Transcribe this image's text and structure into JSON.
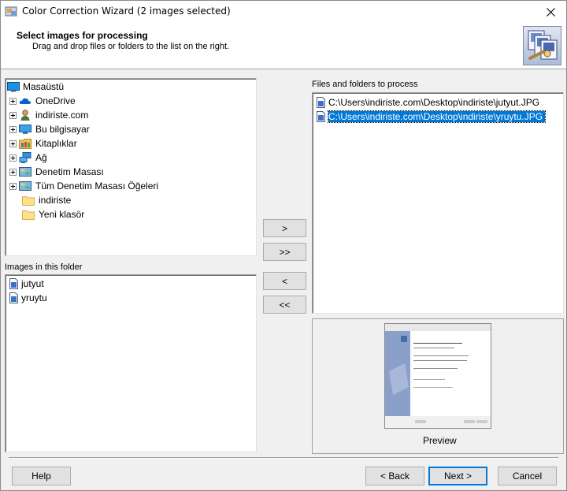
{
  "window": {
    "title": "Color Correction Wizard (2 images selected)"
  },
  "header": {
    "title": "Select images for processing",
    "subtitle": "Drag and drop files or folders to the list on the right."
  },
  "tree": {
    "root": "Masaüstü",
    "items": [
      {
        "label": "OneDrive",
        "icon": "cloud-icon",
        "expandable": true
      },
      {
        "label": "indiriste.com",
        "icon": "user-icon",
        "expandable": true
      },
      {
        "label": "Bu bilgisayar",
        "icon": "computer-icon",
        "expandable": true
      },
      {
        "label": "Kitaplıklar",
        "icon": "library-icon",
        "expandable": true
      },
      {
        "label": "Ağ",
        "icon": "network-icon",
        "expandable": true
      },
      {
        "label": "Denetim Masası",
        "icon": "control-panel-icon",
        "expandable": true
      },
      {
        "label": "Tüm Denetim Masası Öğeleri",
        "icon": "control-panel-icon",
        "expandable": true
      },
      {
        "label": "indiriste",
        "icon": "folder-icon",
        "expandable": false
      },
      {
        "label": "Yeni klasör",
        "icon": "folder-icon",
        "expandable": false
      }
    ]
  },
  "images_panel": {
    "label": "Images in this folder",
    "items": [
      "jutyut",
      "yruytu"
    ]
  },
  "files_panel": {
    "label": "Files and folders to process",
    "items": [
      "C:\\Users\\indiriste.com\\Desktop\\indiriste\\jutyut.JPG",
      "C:\\Users\\indiriste.com\\Desktop\\indiriste\\yruytu.JPG"
    ],
    "selected_index": 1
  },
  "transfer_buttons": {
    "add": ">",
    "add_all": ">>",
    "remove": "<",
    "remove_all": "<<"
  },
  "preview": {
    "label": "Preview"
  },
  "footer": {
    "help": "Help",
    "back": "< Back",
    "next": "Next >",
    "cancel": "Cancel"
  },
  "colors": {
    "selection": "#0078d7",
    "button_face": "#e1e1e1",
    "dialog_bg": "#f0f0f0"
  }
}
